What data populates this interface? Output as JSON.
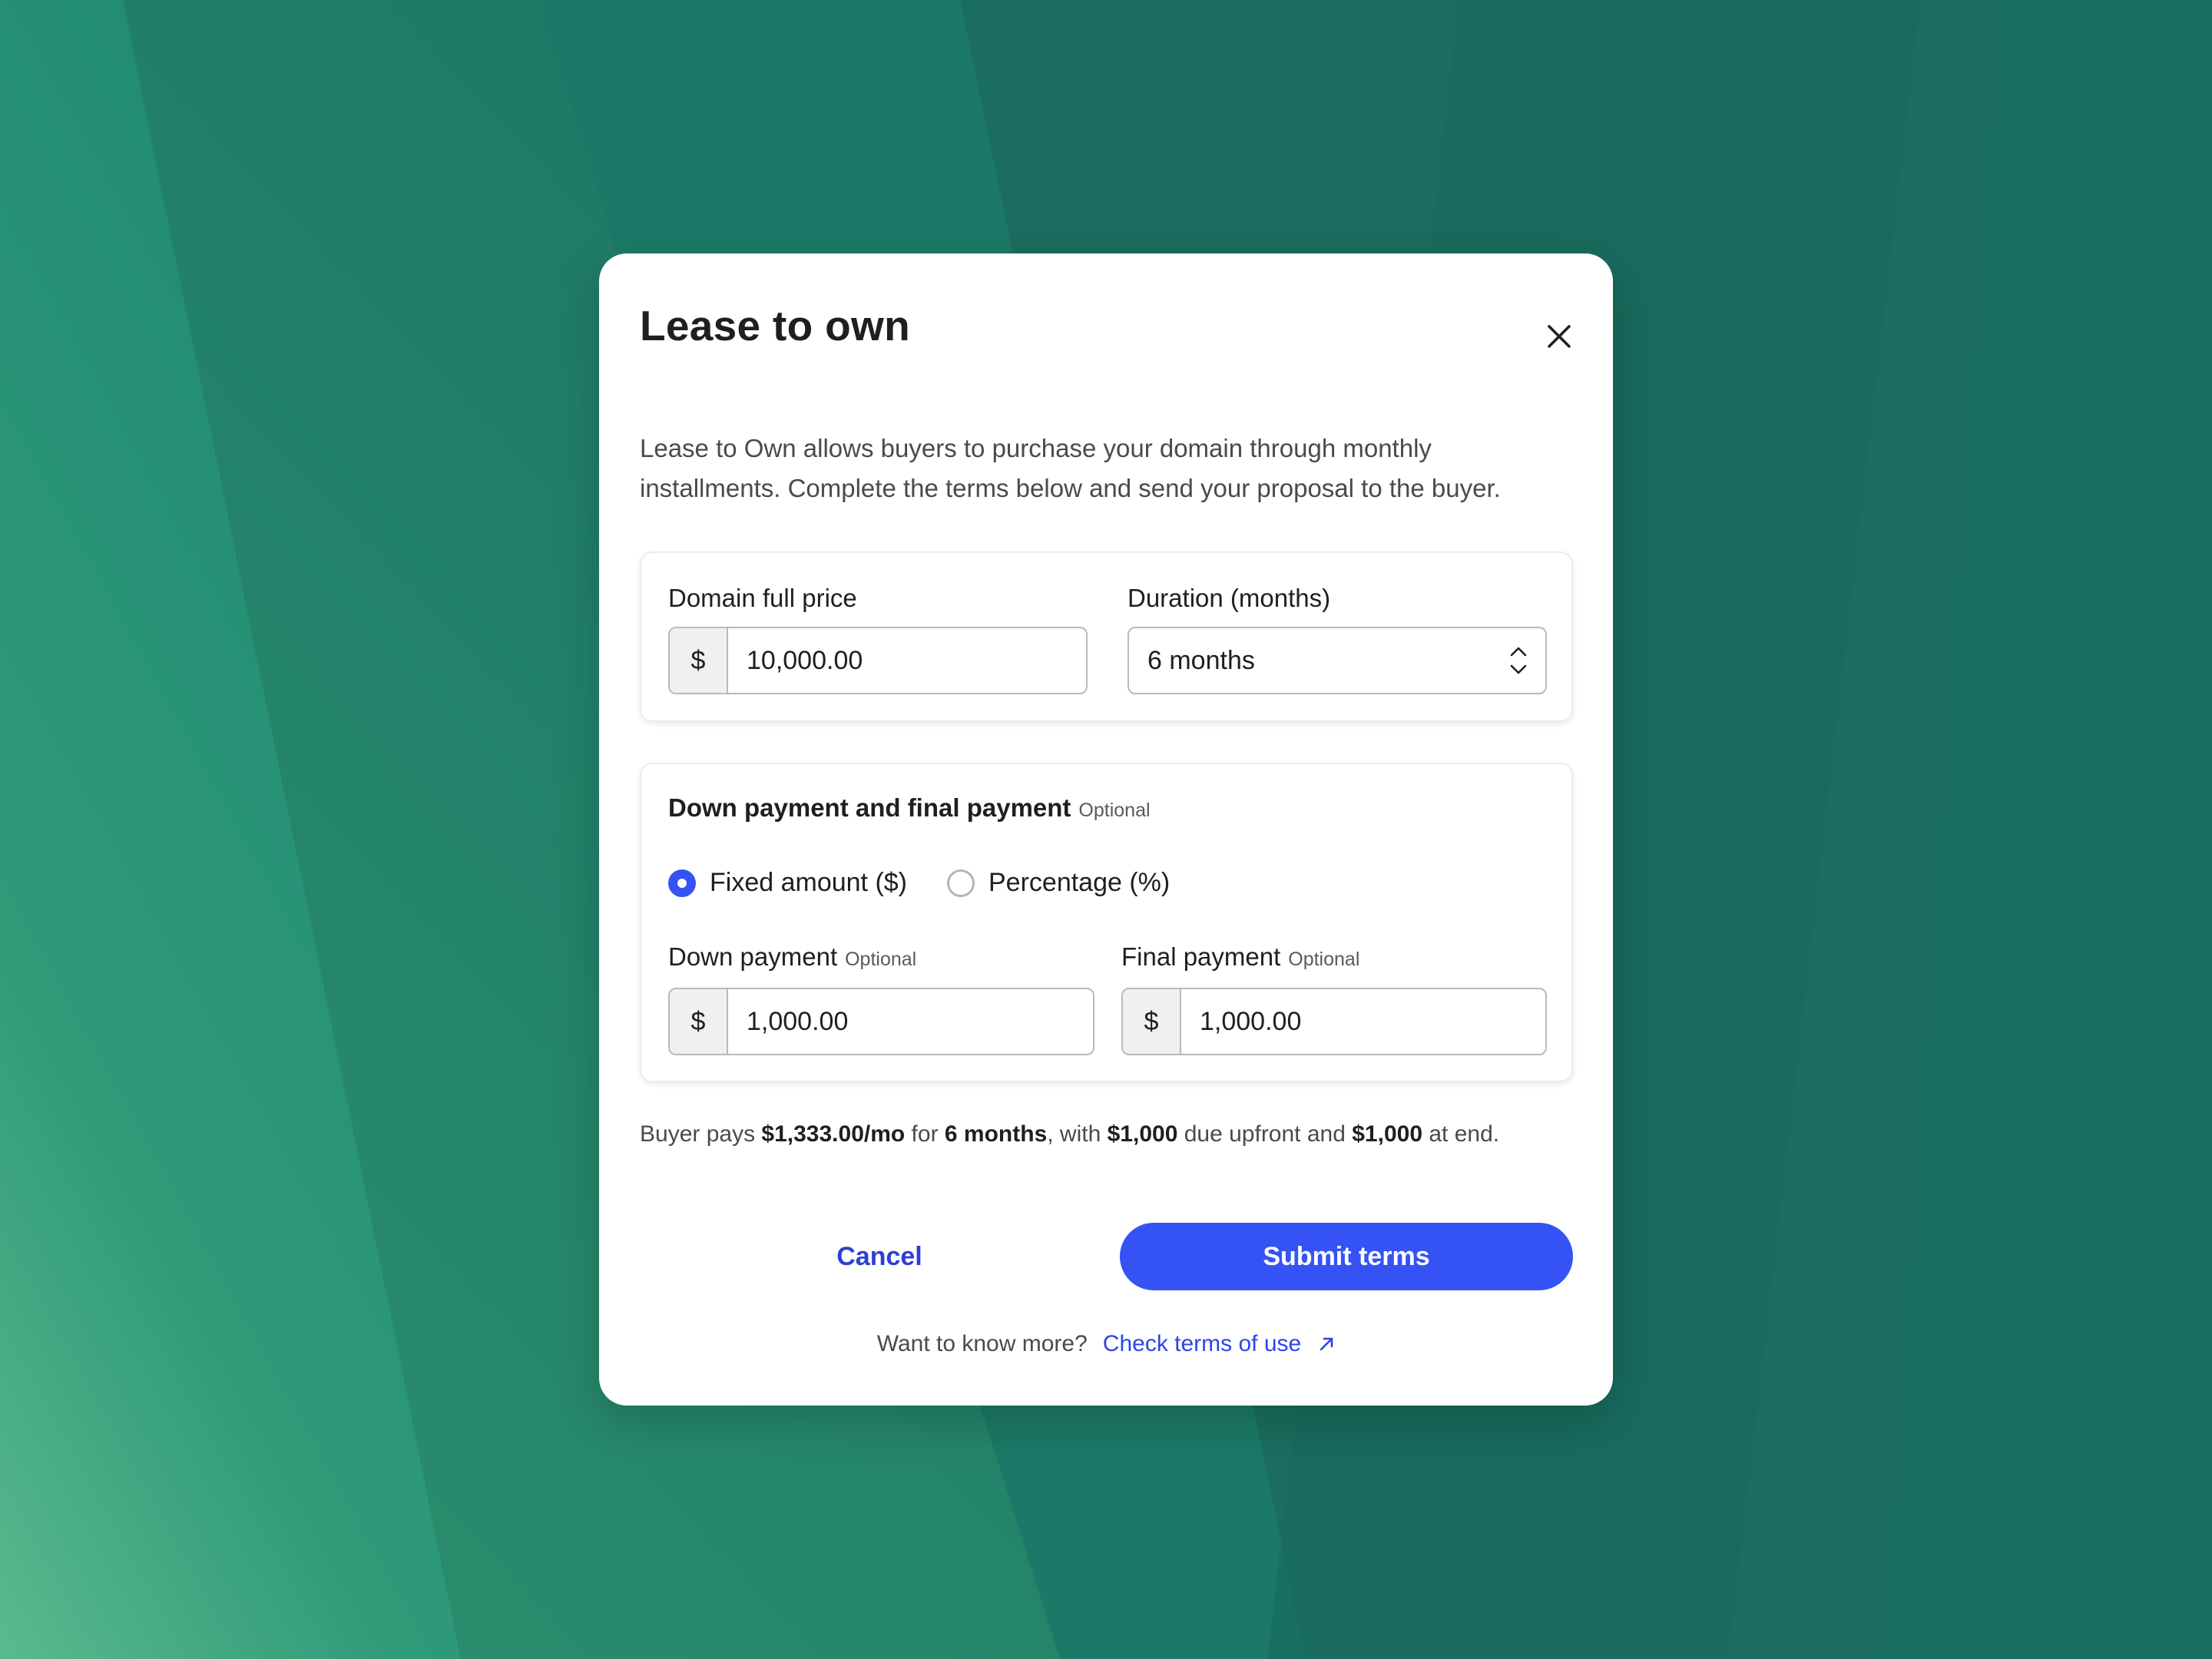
{
  "colors": {
    "accent": "#3553f5",
    "link": "#2c45e8",
    "background": "#1a6d5f"
  },
  "modal": {
    "title": "Lease to own",
    "close_icon": "close-icon",
    "intro_line1": "Lease to Own allows buyers to purchase your domain through monthly",
    "intro_line2": "installments. Complete the terms below and send your proposal to the buyer."
  },
  "pricing": {
    "price_label": "Domain full price",
    "currency_symbol": "$",
    "price_value": "10,000.00",
    "duration_label": "Duration (months)",
    "duration_value": "6 months",
    "stepper_icons": [
      "chevron-up-icon",
      "chevron-down-icon"
    ]
  },
  "payments": {
    "section_title": "Down payment and final payment",
    "optional_tag": "Optional",
    "options": [
      {
        "label": "Fixed amount ($)",
        "checked": true
      },
      {
        "label": "Percentage (%)",
        "checked": false
      }
    ],
    "down_label": "Down payment",
    "down_optional": "Optional",
    "down_currency": "$",
    "down_value": "1,000.00",
    "final_label": "Final payment",
    "final_optional": "Optional",
    "final_currency": "$",
    "final_value": "1,000.00"
  },
  "summary": {
    "prefix": "Buyer pays ",
    "monthly": "$1,333.00/mo",
    "for_text": " for ",
    "duration": "6 months",
    "with_text": ", with ",
    "upfront": "$1,000",
    "upfront_text": " due upfront and ",
    "end": "$1,000",
    "end_text": " at end."
  },
  "actions": {
    "cancel_label": "Cancel",
    "submit_label": "Submit terms"
  },
  "footer": {
    "question": "Want to know more?",
    "link_label": "Check terms of use",
    "link_icon": "external-link-icon"
  }
}
